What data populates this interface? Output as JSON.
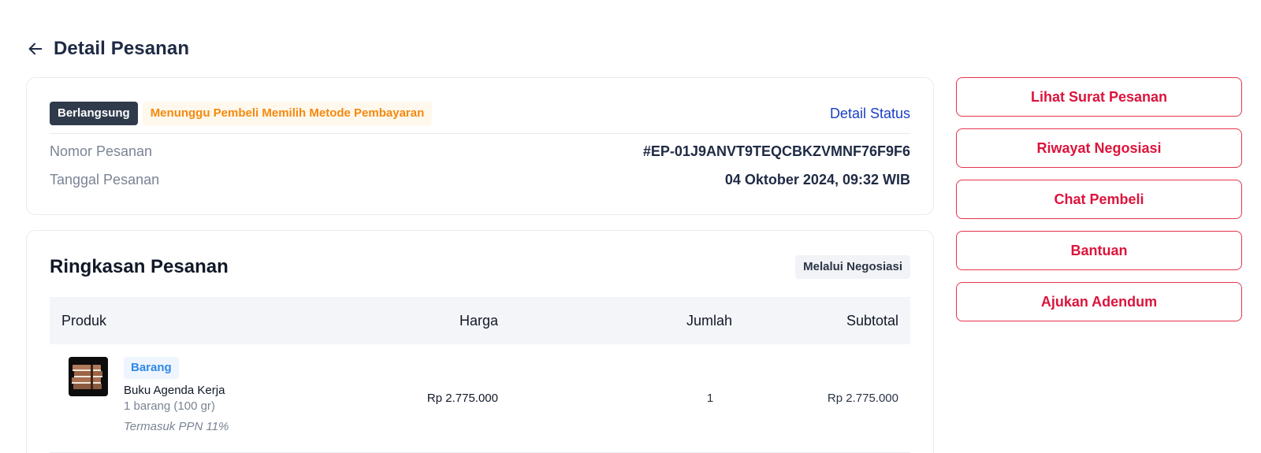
{
  "header": {
    "title": "Detail Pesanan",
    "back_icon": "arrow-left-icon"
  },
  "status": {
    "state_badge": "Berlangsung",
    "state_detail": "Menunggu Pembeli Memilih Metode Pembayaran",
    "detail_link": "Detail Status",
    "order_number_label": "Nomor Pesanan",
    "order_number_value": "#EP-01J9ANVT9TEQCBKZVMNF76F9F6",
    "order_date_label": "Tanggal Pesanan",
    "order_date_value": "04 Oktober 2024, 09:32 WIB"
  },
  "summary": {
    "title": "Ringkasan Pesanan",
    "method_badge": "Melalui Negosiasi",
    "columns": {
      "product": "Produk",
      "price": "Harga",
      "quantity": "Jumlah",
      "subtotal": "Subtotal"
    },
    "items": [
      {
        "type_badge": "Barang",
        "name": "Buku Agenda Kerja",
        "qty_detail": "1 barang (100 gr)",
        "tax_note": "Termasuk PPN 11%",
        "price": "Rp 2.775.000",
        "quantity": "1",
        "subtotal": "Rp 2.775.000"
      }
    ]
  },
  "actions": [
    {
      "label": "Lihat Surat Pesanan"
    },
    {
      "label": "Riwayat Negosiasi"
    },
    {
      "label": "Chat Pembeli"
    },
    {
      "label": "Bantuan"
    },
    {
      "label": "Ajukan Adendum"
    }
  ],
  "colors": {
    "accent_red": "#dc143c",
    "link_blue": "#1a3ec8",
    "status_orange": "#f5890f",
    "badge_dark": "#2f3a4b"
  }
}
